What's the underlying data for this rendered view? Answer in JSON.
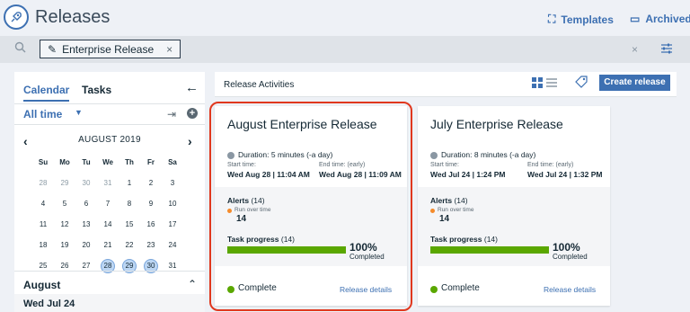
{
  "header": {
    "title": "Releases",
    "templates_label": "Templates",
    "archived_label": "Archived"
  },
  "search": {
    "tag_label": "Enterprise Release",
    "tag_remove": "×",
    "clear": "×"
  },
  "sidebar": {
    "tabs": [
      {
        "label": "Calendar",
        "active": true
      },
      {
        "label": "Tasks",
        "active": false
      }
    ],
    "range_label": "All time",
    "calendar": {
      "month_label": "AUGUST 2019",
      "weekdays": [
        "Su",
        "Mo",
        "Tu",
        "We",
        "Th",
        "Fr",
        "Sa"
      ],
      "weeks": [
        [
          "28",
          "29",
          "30",
          "31",
          "1",
          "2",
          "3"
        ],
        [
          "4",
          "5",
          "6",
          "7",
          "8",
          "9",
          "10"
        ],
        [
          "11",
          "12",
          "13",
          "14",
          "15",
          "16",
          "17"
        ],
        [
          "18",
          "19",
          "20",
          "21",
          "22",
          "23",
          "24"
        ],
        [
          "25",
          "26",
          "27",
          "28",
          "29",
          "30",
          "31"
        ]
      ],
      "muted_first_week": [
        "28",
        "29",
        "30",
        "31"
      ],
      "selected_range": [
        "28",
        "29",
        "30"
      ]
    },
    "section_title": "August",
    "section_item": "Wed Jul 24"
  },
  "main": {
    "toolbar_title": "Release Activities",
    "create_label": "Create release",
    "cards": [
      {
        "title": "August Enterprise Release",
        "duration": "Duration: 5 minutes (-a day)",
        "start_label": "Start time:",
        "end_label": "End time:  (early)",
        "start_value": "Wed Aug 28 | 11:04 AM",
        "end_value": "Wed Aug 28 | 11:09 AM",
        "alerts_label": "Alerts",
        "alerts_count": "(14)",
        "rot_label": "Run over time",
        "rot_value": "14",
        "tp_label": "Task progress",
        "tp_count": "(14)",
        "progress": 1.0,
        "pct": "100%",
        "completed": "Completed",
        "status": "Complete",
        "details": "Release details"
      },
      {
        "title": "July Enterprise Release",
        "duration": "Duration: 8 minutes (-a day)",
        "start_label": "Start time:",
        "end_label": "End time:  (early)",
        "start_value": "Wed Jul 24 | 1:24 PM",
        "end_value": "Wed Jul 24 | 1:32 PM",
        "alerts_label": "Alerts",
        "alerts_count": "(14)",
        "rot_label": "Run over time",
        "rot_value": "14",
        "tp_label": "Task progress",
        "tp_count": "(14)",
        "progress": 1.0,
        "pct": "100%",
        "completed": "Completed",
        "status": "Complete",
        "details": "Release details"
      }
    ]
  },
  "colors": {
    "accent": "#3d70b2",
    "success": "#5aa700",
    "alert": "#f58b2b",
    "highlight": "#e0381e"
  }
}
